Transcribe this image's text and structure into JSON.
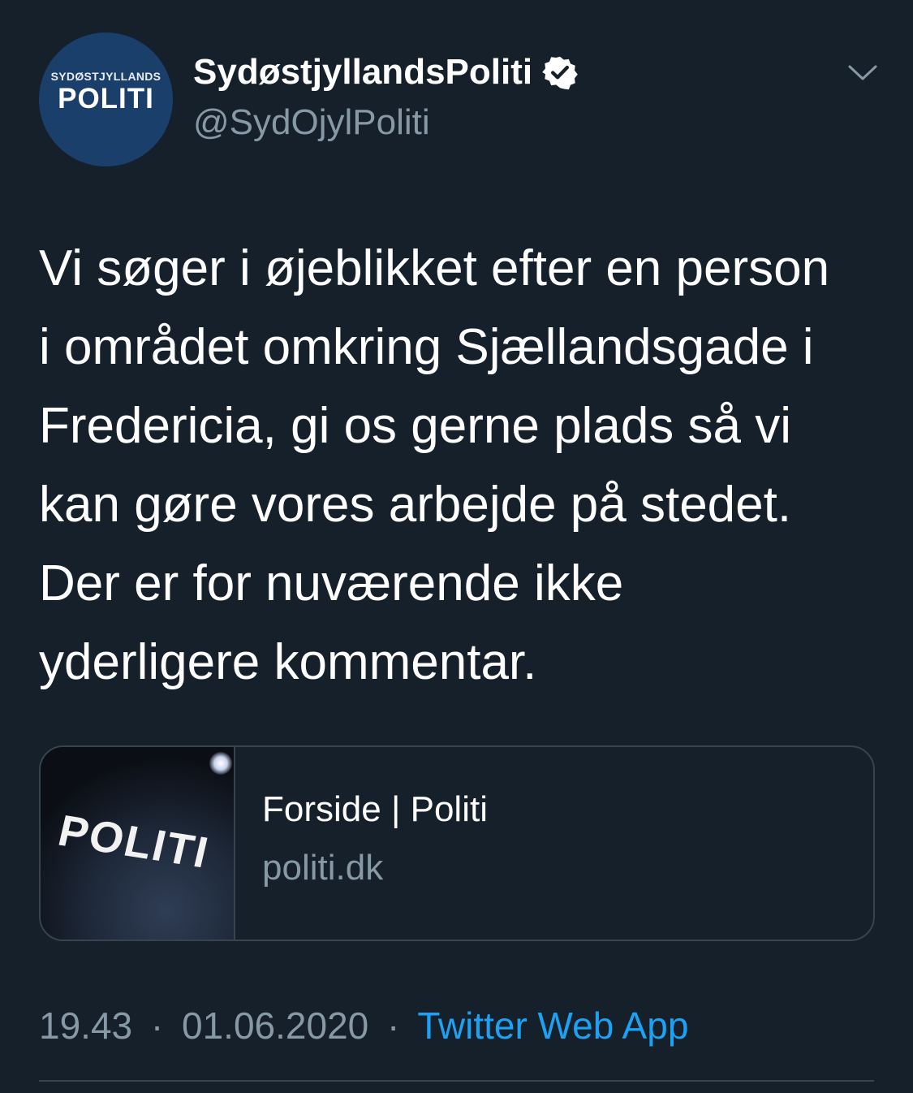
{
  "author": {
    "avatar_line1": "SYDØSTJYLLANDS",
    "avatar_line2": "POLITI",
    "name": "SydøstjyllandsPoliti",
    "handle": "@SydOjylPoliti",
    "verified": true,
    "verified_icon": "verified-badge-icon"
  },
  "menu_icon": "chevron-down-icon",
  "tweet": {
    "lines": [
      "Vi søger i øjeblikket efter en person",
      "i området omkring Sjællandsgade i",
      "Fredericia, gi os gerne plads så vi",
      "kan gøre vores arbejde på stedet.",
      "Der er for nuværende ikke",
      "yderligere kommentar."
    ]
  },
  "link_card": {
    "thumbnail_text": "POLITI",
    "title": "Forside | Politi",
    "domain": "politi.dk"
  },
  "meta": {
    "time": "19.43",
    "separator": "·",
    "date": "01.06.2020",
    "source": "Twitter Web App"
  },
  "colors": {
    "background": "#15202b",
    "text": "#ffffff",
    "muted": "#8899a6",
    "link": "#1da1f2",
    "border": "#38444d",
    "avatar_bg": "#1b3f6b"
  }
}
